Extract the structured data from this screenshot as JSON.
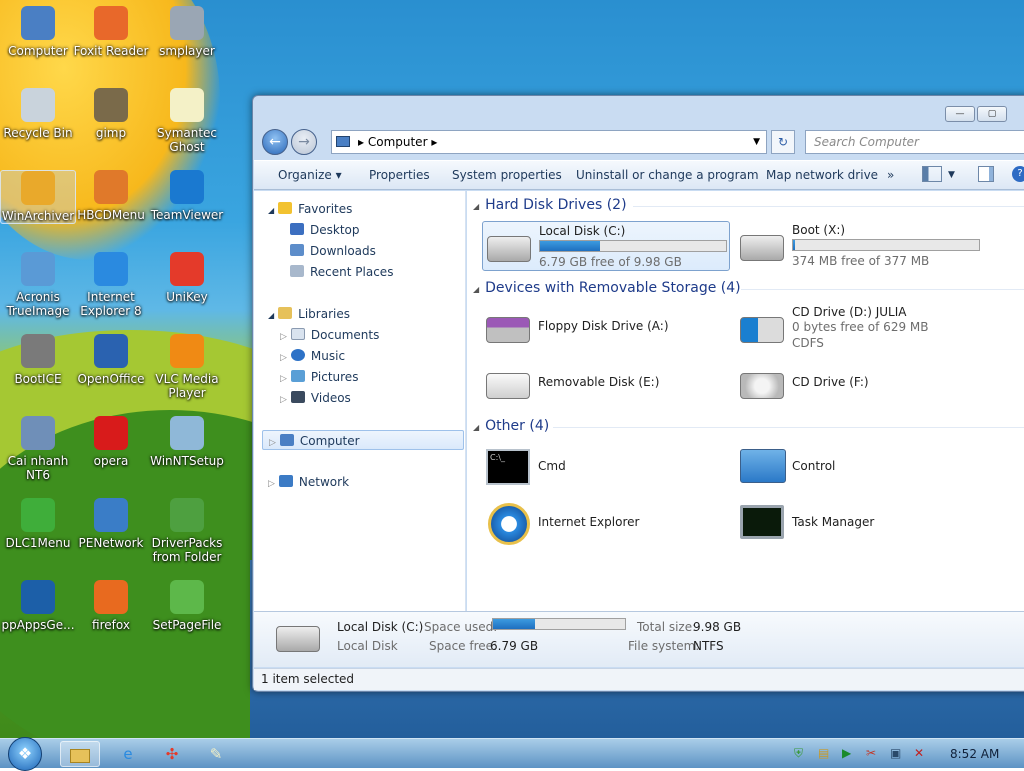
{
  "desktop_icons": [
    {
      "label": "Computer",
      "icon": "computer-icon",
      "color": "#4a7fc4"
    },
    {
      "label": "Foxit Reader",
      "icon": "pdf-icon",
      "color": "#e8682a"
    },
    {
      "label": "smplayer",
      "icon": "media-player-icon",
      "color": "#9aa6b4"
    },
    {
      "label": "Recycle Bin",
      "icon": "recycle-bin-icon",
      "color": "#c9d3dc"
    },
    {
      "label": "gimp",
      "icon": "gimp-icon",
      "color": "#7a6a4a"
    },
    {
      "label": "Symantec Ghost",
      "icon": "ghost-icon",
      "color": "#f4f1c7"
    },
    {
      "label": "WinArchiver",
      "icon": "archive-icon",
      "color": "#e9a92b"
    },
    {
      "label": "HBCDMenu",
      "icon": "tools-icon",
      "color": "#e0792a"
    },
    {
      "label": "TeamViewer",
      "icon": "teamviewer-icon",
      "color": "#1a79d0"
    },
    {
      "label": "Acronis TrueImage",
      "icon": "acronis-icon",
      "color": "#5a9ad6"
    },
    {
      "label": "Internet Explorer 8",
      "icon": "ie-icon",
      "color": "#2a8ae0"
    },
    {
      "label": "UniKey",
      "icon": "unikey-icon",
      "color": "#e43a2a"
    },
    {
      "label": "BootICE",
      "icon": "bootice-icon",
      "color": "#7a7a7a"
    },
    {
      "label": "OpenOffice",
      "icon": "openoffice-icon",
      "color": "#2a62b0"
    },
    {
      "label": "VLC Media Player",
      "icon": "vlc-icon",
      "color": "#f08a14"
    },
    {
      "label": "Cai nhanh NT6",
      "icon": "installer-icon",
      "color": "#6f8fb8"
    },
    {
      "label": "opera",
      "icon": "opera-icon",
      "color": "#d81b1b"
    },
    {
      "label": "WinNTSetup",
      "icon": "setup-icon",
      "color": "#8fb8d8"
    },
    {
      "label": "DLC1Menu",
      "icon": "dlc-icon",
      "color": "#3fae3a"
    },
    {
      "label": "PENetwork",
      "icon": "network-icon",
      "color": "#3a7dc7"
    },
    {
      "label": "DriverPacks from Folder",
      "icon": "driverpack-icon",
      "color": "#4ea040"
    },
    {
      "label": "ppAppsGe...",
      "icon": "ppapps-icon",
      "color": "#1c5fa8"
    },
    {
      "label": "firefox",
      "icon": "firefox-icon",
      "color": "#e86a1f"
    },
    {
      "label": "SetPageFile",
      "icon": "pagefile-icon",
      "color": "#5db84a"
    }
  ],
  "window": {
    "address_root": "Computer",
    "search_placeholder": "Search Computer",
    "minimize": "—",
    "maximize": "▢",
    "back": "←",
    "forward": "→",
    "refresh": "↻"
  },
  "commandbar": {
    "organize": "Organize ▾",
    "properties": "Properties",
    "system_properties": "System properties",
    "uninstall": "Uninstall or change a program",
    "map_drive": "Map network drive",
    "more": "»"
  },
  "nav": {
    "favorites": "Favorites",
    "desktop": "Desktop",
    "downloads": "Downloads",
    "recent": "Recent Places",
    "libraries": "Libraries",
    "documents": "Documents",
    "music": "Music",
    "pictures": "Pictures",
    "videos": "Videos",
    "computer": "Computer",
    "network": "Network"
  },
  "groups": {
    "hdd": "Hard Disk Drives (2)",
    "removable": "Devices with Removable Storage (4)",
    "other": "Other (4)"
  },
  "drives": {
    "c": {
      "name": "Local Disk (C:)",
      "free": "6.79 GB free of 9.98 GB",
      "used_fraction": 0.32
    },
    "x": {
      "name": "Boot (X:)",
      "free": "374 MB free of 377 MB",
      "used_fraction": 0.01
    },
    "a": {
      "name": "Floppy Disk Drive (A:)"
    },
    "d": {
      "name": "CD Drive (D:) JULIA",
      "free": "0 bytes free of 629 MB",
      "fs": "CDFS"
    },
    "e": {
      "name": "Removable Disk (E:)"
    },
    "f": {
      "name": "CD Drive (F:)"
    }
  },
  "other": {
    "cmd": "Cmd",
    "control": "Control",
    "ie": "Internet Explorer",
    "taskmgr": "Task Manager"
  },
  "details": {
    "name": "Local Disk (C:)",
    "type": "Local Disk",
    "space_used_label": "Space used:",
    "space_free_label": "Space free:",
    "space_free": "6.79 GB",
    "total_label": "Total size:",
    "total": "9.98 GB",
    "fs_label": "File system:",
    "fs": "NTFS",
    "used_fraction": 0.32
  },
  "status": "1 item selected",
  "taskbar": {
    "time": "8:52 AM"
  }
}
